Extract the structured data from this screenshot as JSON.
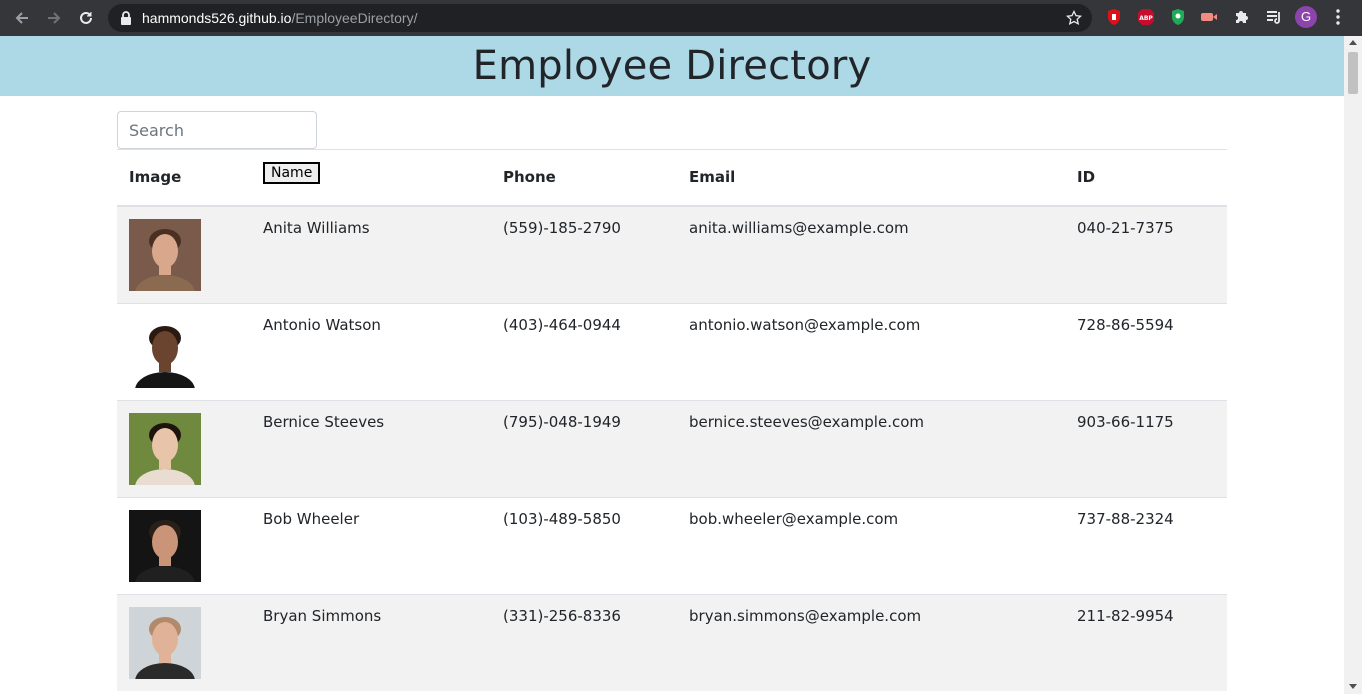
{
  "browser": {
    "url_host": "hammonds526.github.io",
    "url_path": "/EmployeeDirectory/",
    "profile_initial": "G",
    "extensions": [
      "adblocker-icon",
      "abp-icon",
      "shield-icon",
      "media-icon",
      "puzzle-icon",
      "reading-list-icon"
    ]
  },
  "page": {
    "title": "Employee Directory",
    "search_placeholder": "Search"
  },
  "table": {
    "headers": {
      "image": "Image",
      "name": "Name",
      "phone": "Phone",
      "email": "Email",
      "id": "ID"
    },
    "rows": [
      {
        "name": "Anita Williams",
        "phone": "(559)-185-2790",
        "email": "anita.williams@example.com",
        "id": "040-21-7375",
        "avatar_bg": "#7a5a4a",
        "avatar_skin": "#d9a88c",
        "avatar_hair": "#4a3020",
        "avatar_shirt": "#8a6a50"
      },
      {
        "name": "Antonio Watson",
        "phone": "(403)-464-0944",
        "email": "antonio.watson@example.com",
        "id": "728-86-5594",
        "avatar_bg": "#ffffff",
        "avatar_skin": "#6b4430",
        "avatar_hair": "#2a1a12",
        "avatar_shirt": "#151515"
      },
      {
        "name": "Bernice Steeves",
        "phone": "(795)-048-1949",
        "email": "bernice.steeves@example.com",
        "id": "903-66-1175",
        "avatar_bg": "#6f8a3e",
        "avatar_skin": "#e8c4a8",
        "avatar_hair": "#1e140e",
        "avatar_shirt": "#e8ddd0"
      },
      {
        "name": "Bob Wheeler",
        "phone": "(103)-489-5850",
        "email": "bob.wheeler@example.com",
        "id": "737-88-2324",
        "avatar_bg": "#141414",
        "avatar_skin": "#c99478",
        "avatar_hair": "#2a2018",
        "avatar_shirt": "#202020"
      },
      {
        "name": "Bryan Simmons",
        "phone": "(331)-256-8336",
        "email": "bryan.simmons@example.com",
        "id": "211-82-9954",
        "avatar_bg": "#cfd4d8",
        "avatar_skin": "#e0b398",
        "avatar_hair": "#b08a6a",
        "avatar_shirt": "#2a2a2a"
      }
    ]
  }
}
